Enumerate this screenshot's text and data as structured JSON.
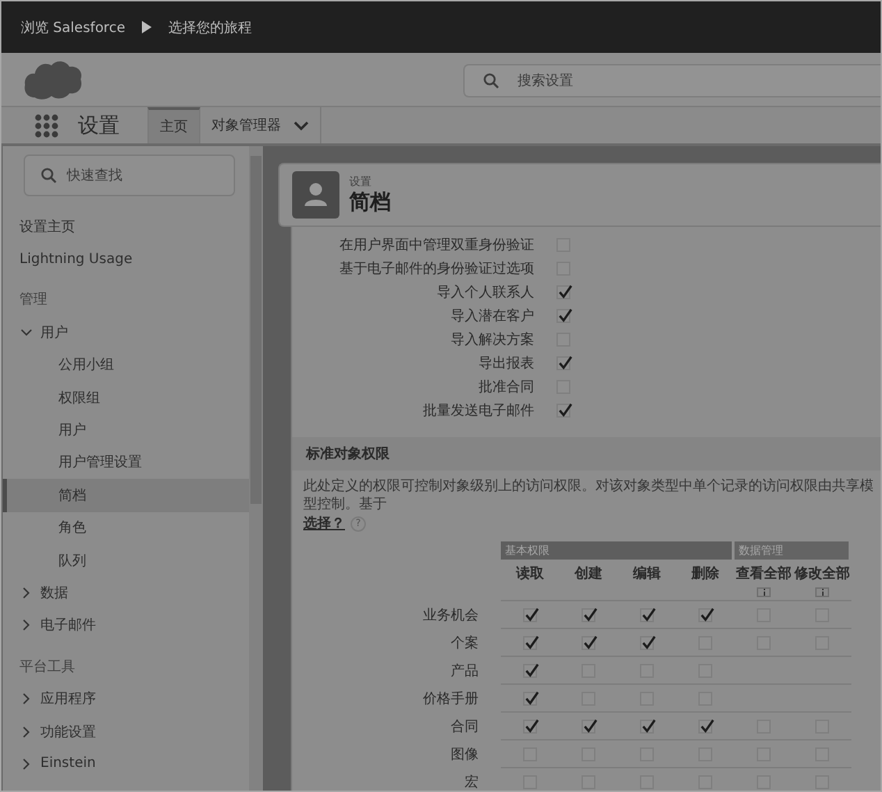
{
  "breadcrumb": {
    "items": [
      "浏览 Salesforce",
      "选择您的旅程"
    ]
  },
  "header": {
    "search": {
      "placeholder": "搜索设置"
    }
  },
  "nav": {
    "app_name": "设置",
    "tabs": [
      {
        "label": "主页",
        "selected": true,
        "has_menu": false
      },
      {
        "label": "对象管理器",
        "selected": false,
        "has_menu": true
      }
    ]
  },
  "sidebar": {
    "search": {
      "placeholder": "快速查找"
    },
    "items": [
      {
        "kind": "link",
        "label": "设置主页",
        "selected": false
      },
      {
        "kind": "link",
        "label": "Lightning Usage",
        "selected": false
      },
      {
        "kind": "heading",
        "label": "管理"
      },
      {
        "kind": "group",
        "label": "用户",
        "expanded": true,
        "children": [
          {
            "label": "公用小组",
            "selected": false
          },
          {
            "label": "权限组",
            "selected": false
          },
          {
            "label": "用户",
            "selected": false
          },
          {
            "label": "用户管理设置",
            "selected": false
          },
          {
            "label": "简档",
            "selected": true
          },
          {
            "label": "角色",
            "selected": false
          },
          {
            "label": "队列",
            "selected": false
          }
        ]
      },
      {
        "kind": "group",
        "label": "数据",
        "expanded": false
      },
      {
        "kind": "group",
        "label": "电子邮件",
        "expanded": false
      },
      {
        "kind": "heading",
        "label": "平台工具"
      },
      {
        "kind": "group",
        "label": "应用程序",
        "expanded": false
      },
      {
        "kind": "group",
        "label": "功能设置",
        "expanded": false
      },
      {
        "kind": "group",
        "label": "Einstein",
        "expanded": false
      }
    ]
  },
  "page_header": {
    "eyebrow": "设置",
    "title": "简档"
  },
  "admin_permissions": [
    {
      "label": "在用户界面中管理双重身份验证",
      "checked": false
    },
    {
      "label": "基于电子邮件的身份验证过选项",
      "checked": false
    },
    {
      "label": "导入个人联系人",
      "checked": true
    },
    {
      "label": "导入潜在客户",
      "checked": true
    },
    {
      "label": "导入解决方案",
      "checked": false
    },
    {
      "label": "导出报表",
      "checked": true
    },
    {
      "label": "批准合同",
      "checked": false
    },
    {
      "label": "批量发送电子邮件",
      "checked": true
    }
  ],
  "object_permissions": {
    "title": "标准对象权限",
    "description": "此处定义的权限可控制对象级别上的访问权限。对该对象类型中单个记录的访问权限由共享模型控制。基于",
    "help_link": "选择？",
    "help_mark": "?",
    "groups": [
      {
        "label": "基本权限",
        "columns": [
          {
            "label": "读取",
            "info": false
          },
          {
            "label": "创建",
            "info": false
          },
          {
            "label": "编辑",
            "info": false
          },
          {
            "label": "删除",
            "info": false
          }
        ]
      },
      {
        "label": "数据管理",
        "columns": [
          {
            "label": "查看全部",
            "info": true
          },
          {
            "label": "修改全部",
            "info": true
          }
        ]
      }
    ],
    "rows": [
      {
        "label": "业务机会",
        "cells": [
          {
            "checked": true
          },
          {
            "checked": true
          },
          {
            "checked": true
          },
          {
            "checked": true
          },
          {
            "checked": false
          },
          {
            "checked": false
          }
        ]
      },
      {
        "label": "个案",
        "cells": [
          {
            "checked": true
          },
          {
            "checked": true
          },
          {
            "checked": true
          },
          {
            "checked": false
          },
          {
            "checked": false
          },
          {
            "checked": false
          }
        ]
      },
      {
        "label": "产品",
        "cells": [
          {
            "checked": true
          },
          {
            "checked": false
          },
          {
            "checked": false
          },
          {
            "checked": false
          }
        ]
      },
      {
        "label": "价格手册",
        "cells": [
          {
            "checked": true
          },
          {
            "checked": false
          },
          {
            "checked": false
          },
          {
            "checked": false
          }
        ]
      },
      {
        "label": "合同",
        "cells": [
          {
            "checked": true
          },
          {
            "checked": true
          },
          {
            "checked": true
          },
          {
            "checked": true
          },
          {
            "checked": false
          },
          {
            "checked": false
          }
        ]
      },
      {
        "label": "图像",
        "cells": [
          {
            "checked": false
          },
          {
            "checked": false
          },
          {
            "checked": false
          },
          {
            "checked": false
          },
          {
            "checked": false
          },
          {
            "checked": false
          }
        ]
      },
      {
        "label": "宏",
        "cells": [
          {
            "checked": false
          },
          {
            "checked": false
          },
          {
            "checked": false
          },
          {
            "checked": false
          },
          {
            "checked": false
          },
          {
            "checked": false
          }
        ]
      }
    ]
  }
}
